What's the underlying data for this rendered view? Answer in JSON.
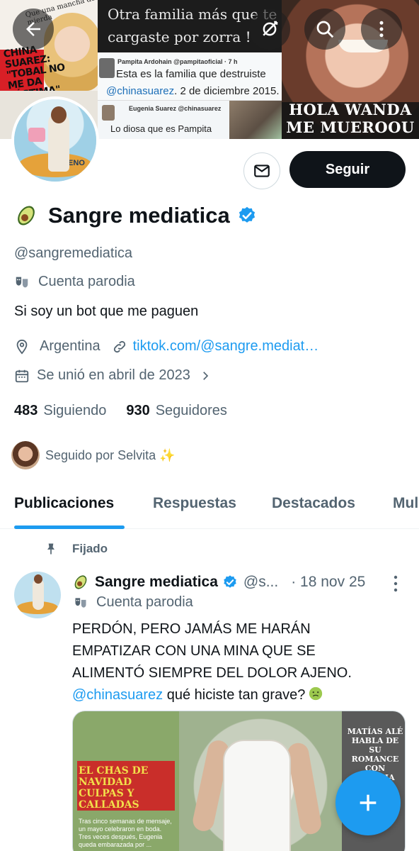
{
  "banner": {
    "magazine_top": "Que una mancha de mierda",
    "magazine_headline": "CHINA SUAREZ: \"TOBAL NO ME DA LÁSTIMA\"",
    "quote_text": "Otra familia más que te cargaste por zorra !",
    "tweet1_name": "Pampita Ardohain @pampitaoficial · 7 h",
    "tweet1_line1": "Esta es la familia que destruiste",
    "tweet1_mention": "@chinasuarez",
    "tweet1_line2_rest": ". 2 de diciembre 2015.",
    "tweet2_name": "Eugenia Suarez @chinasuarez",
    "tweet2_text": "Lo diosa que es Pampita",
    "caption": "HOLA WANDA ME MUEROOU"
  },
  "toolbar": {
    "back_icon": "arrow-left-icon",
    "filter_icon": "eye-slash-icon",
    "search_icon": "search-icon",
    "more_icon": "more-vertical-icon"
  },
  "profile": {
    "avatar_cushion_text": "AJENO",
    "display_name": "Sangre mediatica",
    "handle": "@sangremediatica",
    "parody_label": "Cuenta parodia",
    "bio": "Si soy un bot que me paguen",
    "location": "Argentina",
    "link": "tiktok.com/@sangre.mediat…",
    "joined": "Se unió en abril de 2023",
    "following_count": "483",
    "following_label": "Siguiendo",
    "followers_count": "930",
    "followers_label": "Seguidores",
    "followed_by": "Seguido por Selvita ✨"
  },
  "actions": {
    "follow_label": "Seguir",
    "message_icon": "mail-icon"
  },
  "tabs": [
    {
      "label": "Publicaciones",
      "active": true
    },
    {
      "label": "Respuestas",
      "active": false
    },
    {
      "label": "Destacados",
      "active": false
    },
    {
      "label": "Mul",
      "active": false
    }
  ],
  "post": {
    "pinned_label": "Fijado",
    "name": "Sangre mediatica",
    "handle": "@s...",
    "date": "· 18 nov 25",
    "parody_label": "Cuenta parodia",
    "text_line1": "PERDÓN, PERO JAMÁS ME HARÁN",
    "text_line2": "EMPATIZAR CON UNA MINA QUE SE",
    "text_line3": "ALIMENTÓ SIEMPRE DEL DOLOR AJENO.",
    "mention": "@chinasuarez",
    "text_after_mention": " qué hiciste tan grave?",
    "media_headline": "EL CHAS DE NAVIDAD CULPAS Y CALLADAS",
    "media_tiny": "Tras cinco semanas de mensaje, un mayo celebraron en boda. Tres veces después, Eugenia queda embarazada por ...",
    "media_right_title": "MATÍAS ALÉ HABLA DE SU ROMANCE CON CHECHA CO..."
  },
  "fab": {
    "icon": "plus-icon"
  },
  "colors": {
    "accent": "#1d9bf0",
    "text_primary": "#0f1419",
    "text_secondary": "#536471",
    "follow_button": "#0f1419"
  }
}
